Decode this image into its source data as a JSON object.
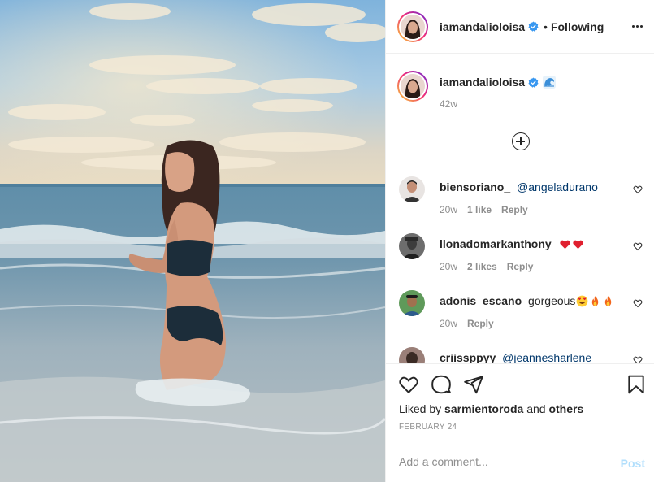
{
  "post_author": {
    "username": "iamandalioloisa",
    "verified": true,
    "separator": "•",
    "follow_status": "Following"
  },
  "caption": {
    "username": "iamandalioloisa",
    "emoji": "wave-icon",
    "time": "42w"
  },
  "comments": [
    {
      "username": "biensoriano_",
      "mention": "@angeladurano",
      "text": "",
      "time": "20w",
      "likes": "1 like",
      "reply": "Reply"
    },
    {
      "username": "llonadomarkanthony",
      "mention": "",
      "text": "",
      "emojis": [
        "red-heart-icon",
        "red-heart-icon"
      ],
      "time": "20w",
      "likes": "2 likes",
      "reply": "Reply"
    },
    {
      "username": "adonis_escano",
      "mention": "",
      "text": "gorgeous",
      "emojis": [
        "heart-eyes-icon",
        "fire-icon",
        "fire-icon"
      ],
      "time": "20w",
      "likes": "",
      "reply": "Reply"
    },
    {
      "username": "criissppyy",
      "mention": "@jeannesharlene",
      "text": ""
    }
  ],
  "liked_by": {
    "prefix": "Liked by",
    "user": "sarmientoroda",
    "and": "and",
    "others": "others"
  },
  "date": "FEBRUARY 24",
  "add_comment": {
    "placeholder": "Add a comment...",
    "post_label": "Post"
  },
  "colors": {
    "verified_blue": "#3897f0",
    "mention_blue": "#00376b",
    "post_disabled": "#b2dffc",
    "heart_red": "#ed4956"
  }
}
